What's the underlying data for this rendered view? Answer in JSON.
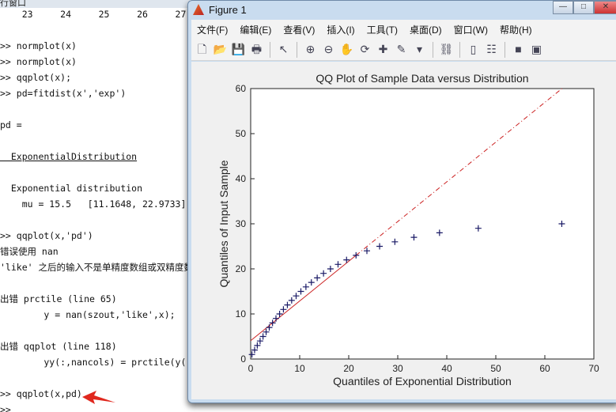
{
  "command_window": {
    "header": "行窗口",
    "lines": [
      {
        "text": "    23     24     25     26     27",
        "cls": ""
      },
      {
        "text": ">> normplot(x)",
        "cls": ""
      },
      {
        "text": ">> normplot(x)",
        "cls": ""
      },
      {
        "text": ">> qqplot(x);",
        "cls": ""
      },
      {
        "text": ">> pd=fitdist(x','exp')",
        "cls": ""
      },
      {
        "text": "pd =",
        "cls": ""
      },
      {
        "text": "  ExponentialDistribution",
        "cls": "lnk"
      },
      {
        "text": "  Exponential distribution",
        "cls": ""
      },
      {
        "text": "    mu = 15.5   [11.1648, 22.9733]",
        "cls": ""
      },
      {
        "text": ">> qqplot(x,'pd')",
        "cls": ""
      },
      {
        "text": "错误使用 nan",
        "cls": "err"
      },
      {
        "text": "'like' 之后的输入不是单精度数组或双精度数组",
        "cls": "err"
      },
      {
        "text": "出错 prctile (line 65)",
        "cls": "err"
      },
      {
        "text": "        y = nan(szout,'like',x);",
        "cls": "err"
      },
      {
        "text": "出错 qqplot (line 118)",
        "cls": "err"
      },
      {
        "text": "        yy(:,nancols) = prctile(y(:,nancols),pvec);",
        "cls": "err"
      },
      {
        "text": ">> qqplot(x,pd)",
        "cls": ""
      },
      {
        "text": ">>",
        "cls": ""
      }
    ]
  },
  "figure": {
    "title": "Figure 1",
    "window_buttons": [
      "—",
      "□",
      "✕"
    ],
    "menu": [
      "文件(F)",
      "编辑(E)",
      "查看(V)",
      "插入(I)",
      "工具(T)",
      "桌面(D)",
      "窗口(W)",
      "帮助(H)"
    ],
    "toolbar": [
      {
        "name": "new-figure",
        "glyph": "🗋"
      },
      {
        "name": "open-file",
        "glyph": "📂"
      },
      {
        "name": "save",
        "glyph": "💾"
      },
      {
        "name": "print",
        "glyph": "🖶"
      },
      {
        "sep": true
      },
      {
        "name": "edit-plot",
        "glyph": "↖"
      },
      {
        "sep": true
      },
      {
        "name": "zoom-in",
        "glyph": "⊕"
      },
      {
        "name": "zoom-out",
        "glyph": "⊖"
      },
      {
        "name": "pan",
        "glyph": "✋"
      },
      {
        "name": "rotate-3d",
        "glyph": "⟳"
      },
      {
        "name": "data-cursor",
        "glyph": "✚"
      },
      {
        "name": "brush",
        "glyph": "✎"
      },
      {
        "name": "brush-dropdown",
        "glyph": "▾"
      },
      {
        "sep": true
      },
      {
        "name": "link-plot",
        "glyph": "⛓"
      },
      {
        "sep": true
      },
      {
        "name": "insert-colorbar",
        "glyph": "▯"
      },
      {
        "name": "insert-legend",
        "glyph": "☷"
      },
      {
        "sep": true
      },
      {
        "name": "hide-plot-tools",
        "glyph": "■"
      },
      {
        "name": "show-plot-tools",
        "glyph": "▣"
      }
    ]
  },
  "chart_data": {
    "type": "scatter",
    "title": "QQ Plot of Sample Data versus Distribution",
    "xlabel": "Quantiles of Exponential Distribution",
    "ylabel": "Quantiles of Input Sample",
    "xlim": [
      0,
      70
    ],
    "ylim": [
      0,
      60
    ],
    "xticks": [
      0,
      10,
      20,
      30,
      40,
      50,
      60,
      70
    ],
    "yticks": [
      0,
      10,
      20,
      30,
      40,
      50,
      60
    ],
    "grid": false,
    "marker": "+",
    "marker_color": "#1a1a66",
    "line_color": "#cc2222",
    "x": [
      0.26,
      0.8,
      1.35,
      1.92,
      2.52,
      3.15,
      3.79,
      4.46,
      5.16,
      5.9,
      6.68,
      7.49,
      8.36,
      9.27,
      10.24,
      11.27,
      12.38,
      13.57,
      14.86,
      16.27,
      17.82,
      19.56,
      21.49,
      23.71,
      26.3,
      29.41,
      33.3,
      38.52,
      46.43,
      63.46
    ],
    "y": [
      1,
      2,
      3,
      4,
      5,
      6,
      7,
      8,
      9,
      10,
      11,
      12,
      13,
      14,
      15,
      16,
      17,
      18,
      19,
      20,
      21,
      22,
      23,
      24,
      25,
      26,
      27,
      28,
      29,
      30
    ],
    "reference_line": {
      "slope": 0.881,
      "intercept": 4.07,
      "solid_range": [
        0.26,
        21.49
      ]
    }
  }
}
